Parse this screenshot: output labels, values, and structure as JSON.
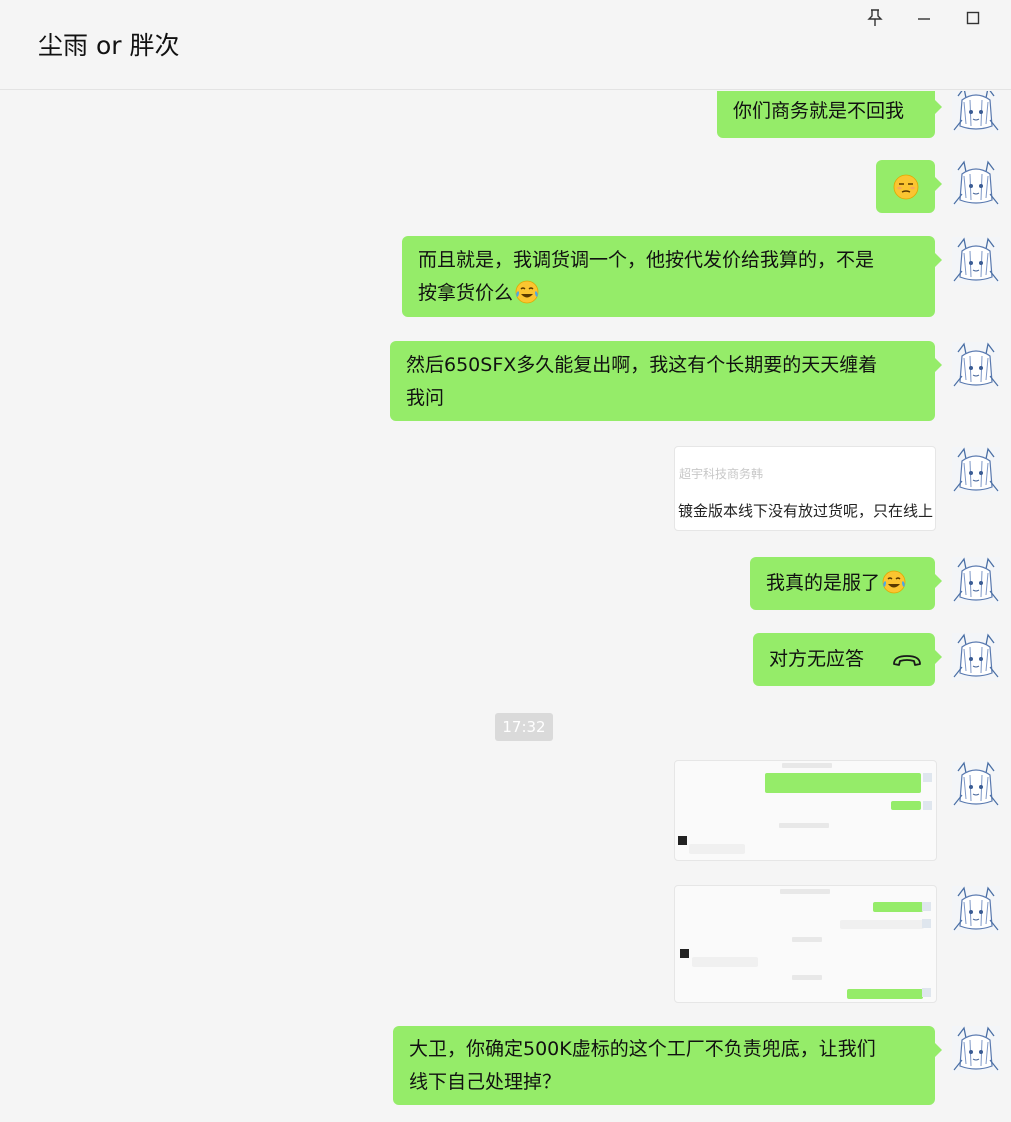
{
  "window": {
    "title": "尘雨 or 胖次",
    "buttons": [
      "pin-icon",
      "minimize-icon",
      "maximize-icon"
    ]
  },
  "colors": {
    "bubble_green": "#95ec69",
    "background": "#f5f5f5",
    "call_icon": "#1a1a1a"
  },
  "messages": {
    "m1": "你们商务就是不回我",
    "m3_line1": "而且就是，我调货调一个，他按代发价给我算的，不是",
    "m3_line2": "按拿货价么",
    "m4_line1": "然后650SFX多久能复出啊，我这有个长期要的天天缠着",
    "m4_line2": "我问",
    "m6": "我真的是服了",
    "m7": "对方无应答",
    "m10_line1": "大卫，你确定500K虚标的这个工厂不负责兜底，让我们",
    "m10_line2": "线下自己处理掉？"
  },
  "screenshot1": {
    "header": "超宇科技商务韩",
    "body": "镀金版本线下没有放过货呢，只在线上"
  },
  "timestamp": "17:32",
  "emoji": {
    "m2": "unamused-face",
    "m3": "crying-laughing-face",
    "m6": "crying-laughing-face",
    "call": "hang-up-phone-icon"
  }
}
